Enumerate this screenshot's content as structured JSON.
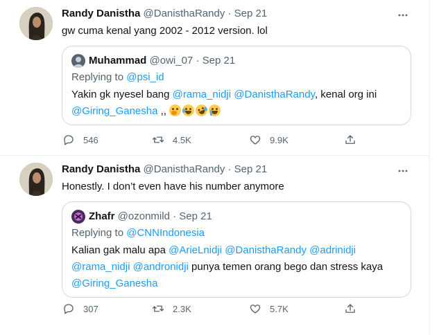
{
  "tweets": [
    {
      "author_name": "Randy Danistha",
      "handle": "@DanisthaRandy",
      "separator": "·",
      "date": "Sep 21",
      "text": "gw cuma kenal yang 2002 - 2012 version. lol",
      "quote": {
        "author_name": "Muhammad",
        "handle": "@owi_07",
        "separator": "·",
        "date": "Sep 21",
        "replying_prefix": "Replying to ",
        "replying_handle": "@psi_id",
        "line1_a": "Yakin gk nyesel bang ",
        "mention1": "@rama_nidji",
        "space1": " ",
        "mention2": "@DanisthaRandy",
        "line1_b": ", kenal org ini",
        "mention3": "@Giring_Ganesha",
        "line2_b": " ,, ",
        "emojis": [
          "shushing-face-emoji",
          "face-with-tears-of-joy-emoji",
          "rolling-on-floor-laughing-emoji",
          "loudly-crying-face-emoji"
        ]
      },
      "stats": {
        "replies": "546",
        "retweets": "4.5K",
        "likes": "9.9K"
      }
    },
    {
      "author_name": "Randy Danistha",
      "handle": "@DanisthaRandy",
      "separator": "·",
      "date": "Sep 21",
      "text": "Honestly. I don’t even have his number anymore",
      "quote": {
        "author_name": "Zhafr",
        "handle": "@ozonmild",
        "separator": "·",
        "date": "Sep 21",
        "replying_prefix": "Replying to ",
        "replying_handle": "@CNNIndonesia",
        "line1_a": "Kalian gak malu apa ",
        "m1": "@ArieLnidji",
        "m2": "@DanisthaRandy",
        "m3": "@adrinidji",
        "m4": "@rama_nidji",
        "m5": "@andronidji",
        "line2_b": " punya temen orang bego dan stress kaya",
        "m6": "@Giring_Ganesha"
      },
      "stats": {
        "replies": "307",
        "retweets": "2.3K",
        "likes": "5.7K"
      }
    }
  ],
  "icons": {
    "more": "more-options-icon",
    "reply": "reply-icon",
    "retweet": "retweet-icon",
    "like": "like-icon",
    "share": "share-icon"
  },
  "colors": {
    "link": "#1d9bf0",
    "muted": "#536471",
    "border": "#cfd9de",
    "text": "#0f1419"
  }
}
